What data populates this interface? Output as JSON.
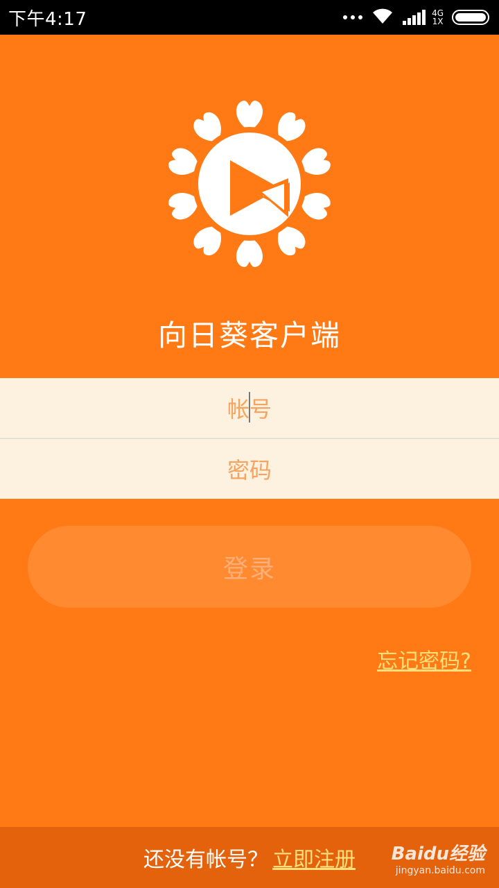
{
  "status_bar": {
    "time": "下午4:17",
    "network_top": "4G",
    "network_bottom": "1X",
    "icons": [
      "more-dots-icon",
      "wifi-icon",
      "signal-icon",
      "battery-icon"
    ]
  },
  "app": {
    "title": "向日葵客户端",
    "logo_icon": "sunflower-play-logo"
  },
  "form": {
    "account_placeholder": "帐号",
    "password_placeholder": "密码"
  },
  "login_button": "登录",
  "forgot_password": "忘记密码?",
  "bottom": {
    "prompt": "还没有帐号？",
    "register_link": "立即注册"
  },
  "watermark": {
    "brand": "Baidu经验",
    "url": "jingyan.baidu.com"
  },
  "colors": {
    "background": "#ff7a14",
    "input_background": "#fdf1e0",
    "bottom_bar": "#e3620b",
    "link": "#ffdf7c"
  }
}
